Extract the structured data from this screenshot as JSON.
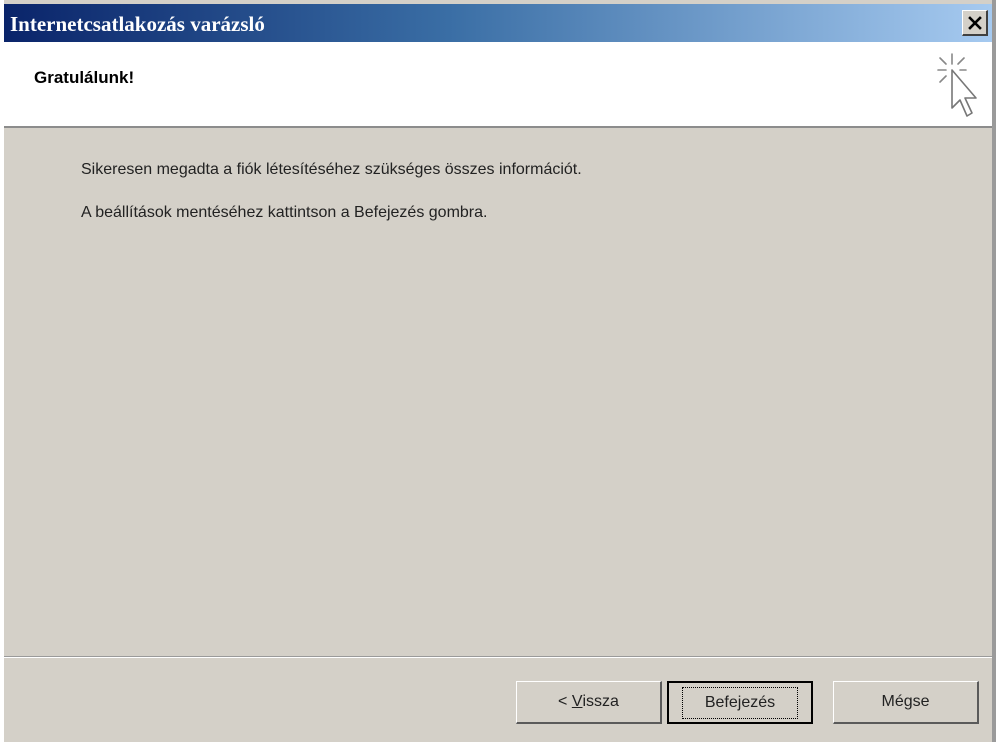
{
  "window": {
    "title": "Internetcsatlakozás varázsló",
    "close_label": "×",
    "close_icon": "close-icon"
  },
  "header": {
    "title": "Gratulálunk!",
    "icon": "wizard-cursor-sparkle-icon"
  },
  "content": {
    "line1": "Sikeresen megadta a fiók létesítéséhez szükséges összes információt.",
    "line2": "A beállítások mentéséhez kattintson a Befejezés gombra."
  },
  "buttons": {
    "back_prefix": "< ",
    "back_accel": "V",
    "back_rest": "issza",
    "finish": "Befejezés",
    "cancel": "Mégse"
  },
  "colors": {
    "title_gradient_start": "#0a246a",
    "title_gradient_end": "#a6caf0",
    "dialog_face": "#d4d0c8",
    "header_bg": "#ffffff"
  }
}
